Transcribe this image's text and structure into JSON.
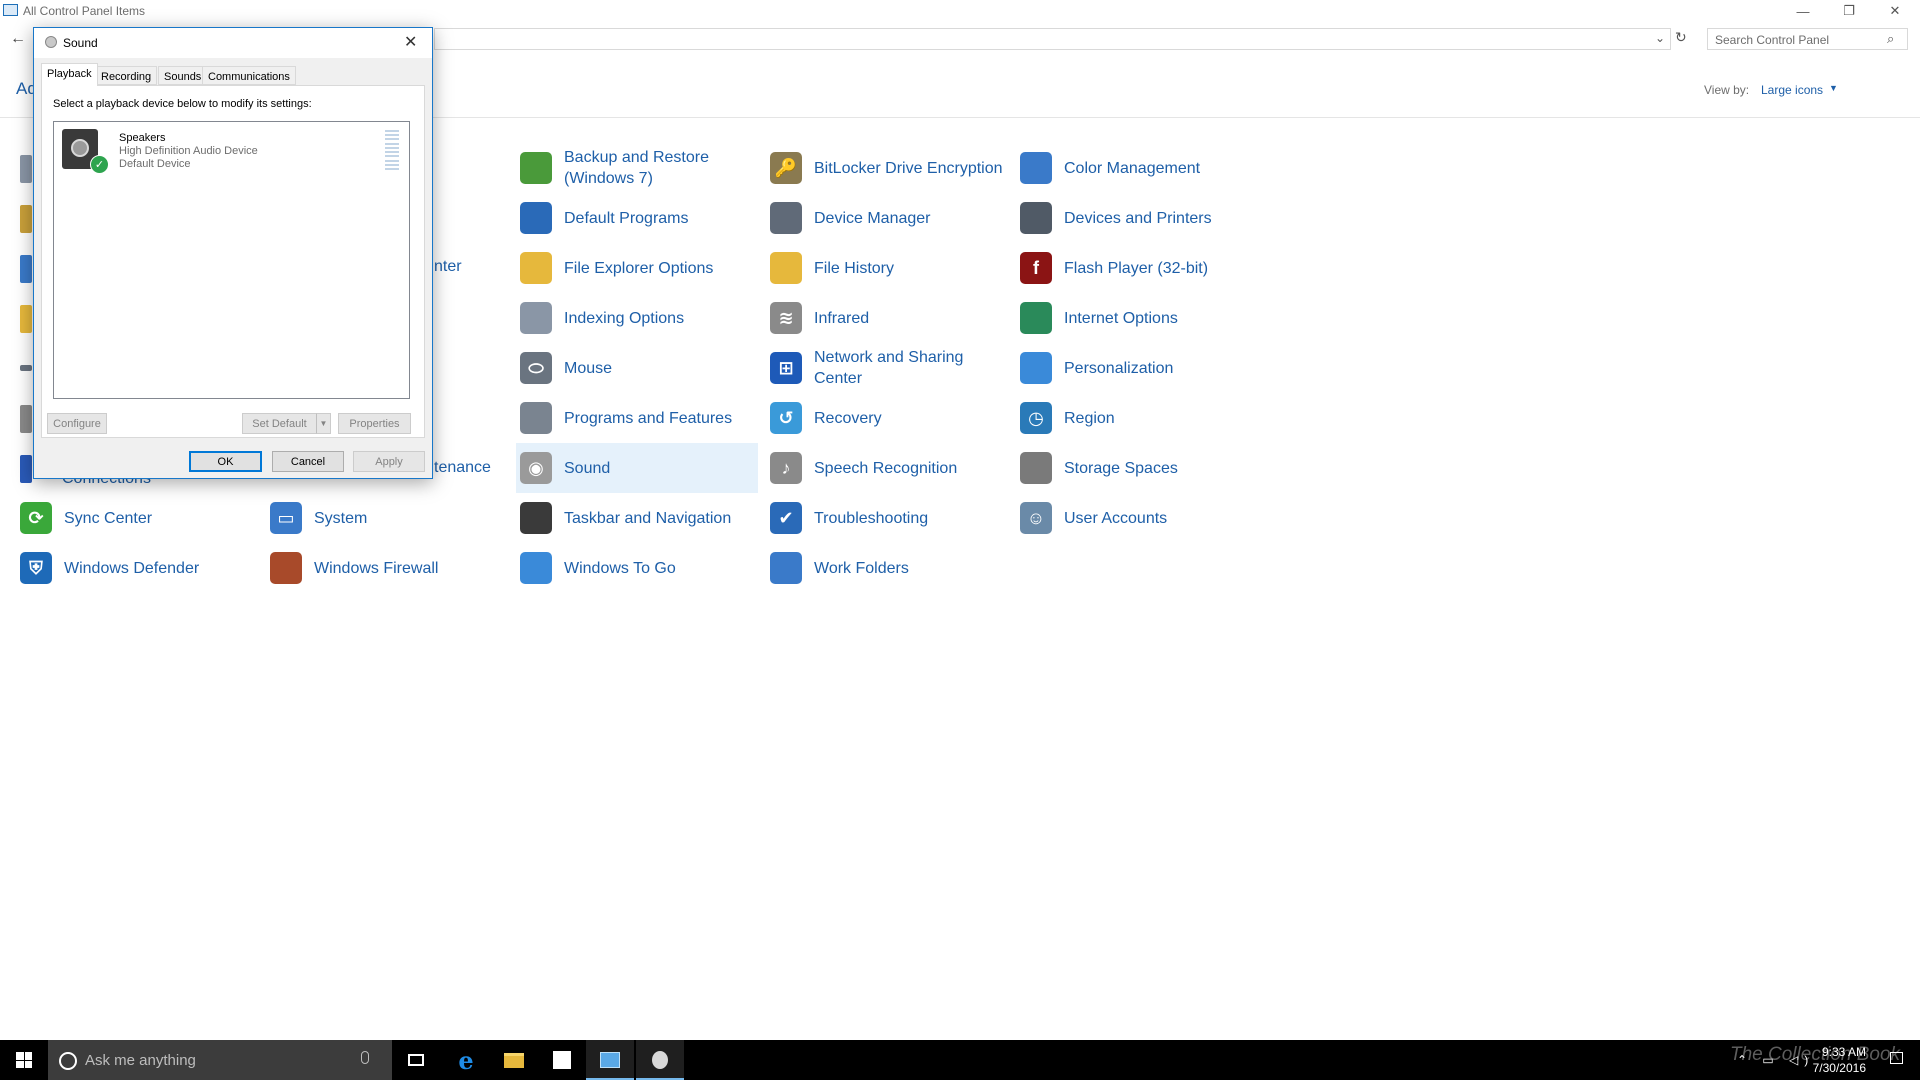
{
  "window": {
    "title": "All Control Panel Items",
    "heading_cut": "Ad",
    "search_placeholder": "Search Control Panel",
    "view_by_label": "View by:",
    "view_by_value": "Large icons",
    "controls": {
      "minimize": "—",
      "restore": "❐",
      "close": "✕"
    }
  },
  "items": [
    {
      "label": "Backup and Restore (Windows 7)",
      "icon": "backup-restore-icon",
      "color": "#4a9a3a"
    },
    {
      "label": "BitLocker Drive Encryption",
      "icon": "bitlocker-icon",
      "color": "#8a7a50"
    },
    {
      "label": "Color Management",
      "icon": "color-management-icon",
      "color": "#3a7ac9"
    },
    {
      "label": "Default Programs",
      "icon": "default-programs-icon",
      "color": "#2a6ab8"
    },
    {
      "label": "Device Manager",
      "icon": "device-manager-icon",
      "color": "#606a78"
    },
    {
      "label": "Devices and Printers",
      "icon": "devices-printers-icon",
      "color": "#505a66"
    },
    {
      "label": "File Explorer Options",
      "icon": "file-explorer-options-icon",
      "color": "#e6b83c"
    },
    {
      "label": "File History",
      "icon": "file-history-icon",
      "color": "#e6b83c"
    },
    {
      "label": "Flash Player (32-bit)",
      "icon": "flash-player-icon",
      "color": "#8b1414"
    },
    {
      "label": "Indexing Options",
      "icon": "indexing-options-icon",
      "color": "#8a96a6"
    },
    {
      "label": "Infrared",
      "icon": "infrared-icon",
      "color": "#8a8a8a"
    },
    {
      "label": "Internet Options",
      "icon": "internet-options-icon",
      "color": "#2a8a5a"
    },
    {
      "label": "Mouse",
      "icon": "mouse-icon",
      "color": "#6a7480"
    },
    {
      "label": "Network and Sharing Center",
      "icon": "network-sharing-icon",
      "color": "#1e5ab8"
    },
    {
      "label": "Personalization",
      "icon": "personalization-icon",
      "color": "#3a8ad9"
    },
    {
      "label": "Programs and Features",
      "icon": "programs-features-icon",
      "color": "#7a8490"
    },
    {
      "label": "Recovery",
      "icon": "recovery-icon",
      "color": "#3a9ad9"
    },
    {
      "label": "Region",
      "icon": "region-icon",
      "color": "#2a7ab8"
    },
    {
      "label": "Sound",
      "icon": "sound-icon",
      "color": "#9a9a9a"
    },
    {
      "label": "Speech Recognition",
      "icon": "speech-recognition-icon",
      "color": "#8a8a8a"
    },
    {
      "label": "Storage Spaces",
      "icon": "storage-spaces-icon",
      "color": "#7a7a7a"
    },
    {
      "label": "Taskbar and Navigation",
      "icon": "taskbar-navigation-icon",
      "color": "#3a3a3a"
    },
    {
      "label": "Troubleshooting",
      "icon": "troubleshooting-icon",
      "color": "#2a6ab8"
    },
    {
      "label": "User Accounts",
      "icon": "user-accounts-icon",
      "color": "#6a8aa8"
    },
    {
      "label": "Sync Center",
      "icon": "sync-center-icon",
      "color": "#3aa83a"
    },
    {
      "label": "System",
      "icon": "system-icon",
      "color": "#3a7ac9"
    },
    {
      "label": "Windows To Go",
      "icon": "windows-to-go-icon",
      "color": "#3a8ad9"
    },
    {
      "label": "Work Folders",
      "icon": "work-folders-icon",
      "color": "#3a7ac9"
    },
    {
      "label": "Windows Defender",
      "icon": "windows-defender-icon",
      "color": "#1e6ab8"
    },
    {
      "label": "Windows Firewall",
      "icon": "windows-firewall-icon",
      "color": "#a84a2a"
    },
    {
      "label": "Connections",
      "icon": "connections-icon",
      "color": "#2a5ab8"
    }
  ],
  "partial_labels": {
    "center_cut": "nter",
    "maintenance_cut": "tenance"
  },
  "dialog": {
    "title": "Sound",
    "tabs": [
      "Playback",
      "Recording",
      "Sounds",
      "Communications"
    ],
    "active_tab": "Playback",
    "instruction": "Select a playback device below to modify its settings:",
    "device": {
      "name": "Speakers",
      "description": "High Definition Audio Device",
      "status": "Default Device"
    },
    "buttons": {
      "configure": "Configure",
      "set_default": "Set Default",
      "properties": "Properties",
      "ok": "OK",
      "cancel": "Cancel",
      "apply": "Apply"
    }
  },
  "taskbar": {
    "search_text": "Ask me anything",
    "time": "9:33 AM",
    "date": "7/30/2016",
    "watermark": "The Collection Book",
    "accent": "#76b9ed"
  }
}
